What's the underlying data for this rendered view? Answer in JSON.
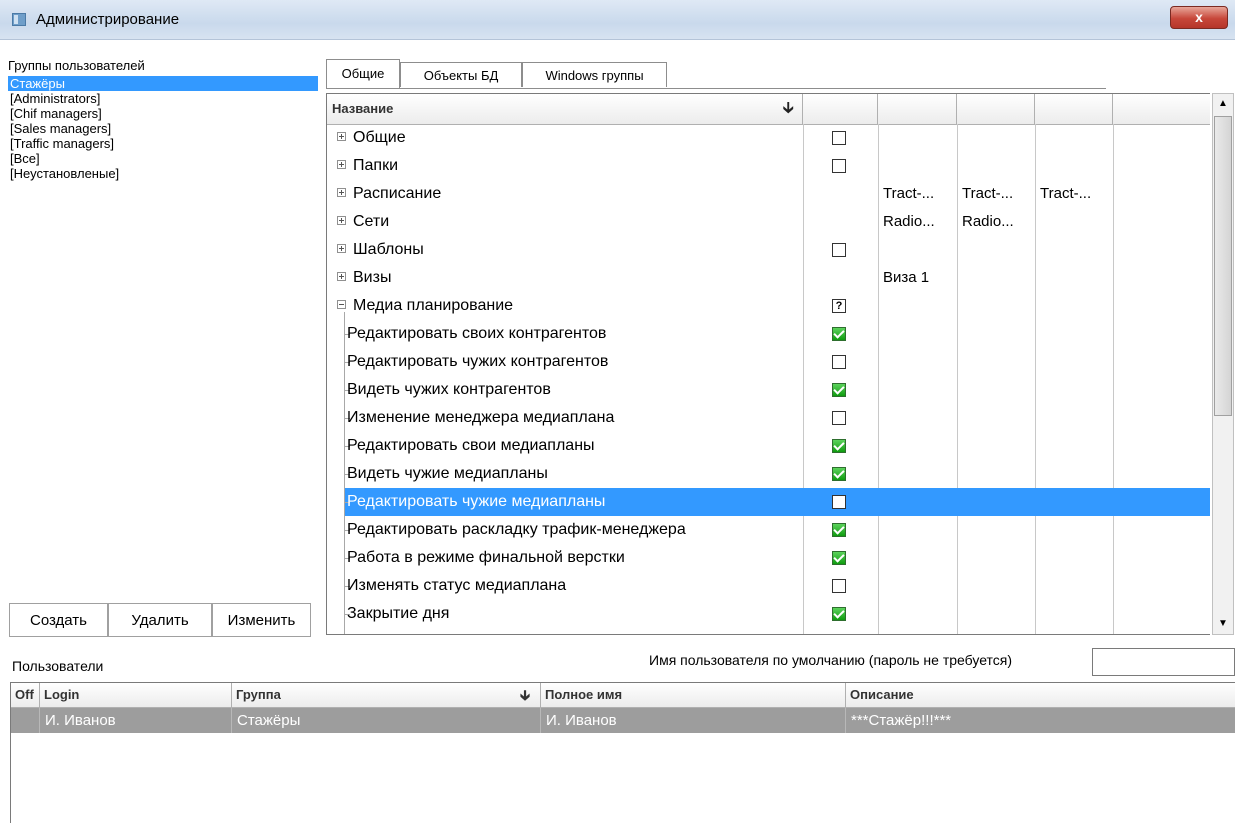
{
  "window": {
    "title": "Администрирование",
    "close_label": "x"
  },
  "groups": {
    "label": "Группы пользователей",
    "items": [
      "Стажёры",
      "[Administrators]",
      "[Chif managers]",
      "[Sales managers]",
      "[Traffic managers]",
      "[Все]",
      "[Неустановленые]"
    ],
    "selected_index": 0,
    "buttons": {
      "create": "Создать",
      "delete": "Удалить",
      "edit": "Изменить"
    }
  },
  "tabs": [
    "Общие",
    "Объекты БД",
    "Windows группы"
  ],
  "grid": {
    "header_name": "Название",
    "sort_icon": "down-arrow-icon",
    "rows": [
      {
        "name": "Общие",
        "type": "group",
        "toggle": "+",
        "check": "unchecked",
        "c1": "",
        "c2": "",
        "c3": ""
      },
      {
        "name": "Папки",
        "type": "group",
        "toggle": "+",
        "check": "unchecked",
        "c1": "",
        "c2": "",
        "c3": ""
      },
      {
        "name": "Расписание",
        "type": "group",
        "toggle": "+",
        "check": "none",
        "c1": "Tract-...",
        "c2": "Tract-...",
        "c3": "Tract-..."
      },
      {
        "name": "Сети",
        "type": "group",
        "toggle": "+",
        "check": "none",
        "c1": "Radio...",
        "c2": "Radio...",
        "c3": ""
      },
      {
        "name": "Шаблоны",
        "type": "group",
        "toggle": "+",
        "check": "unchecked",
        "c1": "",
        "c2": "",
        "c3": ""
      },
      {
        "name": "Визы",
        "type": "group",
        "toggle": "+",
        "check": "none",
        "c1": "Виза 1",
        "c2": "",
        "c3": ""
      },
      {
        "name": "Медиа планирование",
        "type": "group",
        "toggle": "-",
        "check": "indeterminate",
        "c1": "",
        "c2": "",
        "c3": ""
      },
      {
        "name": "Редактировать своих контрагентов",
        "type": "child",
        "check": "checked",
        "c1": "",
        "c2": "",
        "c3": ""
      },
      {
        "name": "Редактировать чужих контрагентов",
        "type": "child",
        "check": "unchecked",
        "c1": "",
        "c2": "",
        "c3": ""
      },
      {
        "name": "Видеть чужих контрагентов",
        "type": "child",
        "check": "checked",
        "c1": "",
        "c2": "",
        "c3": ""
      },
      {
        "name": "Изменение менеджера медиаплана",
        "type": "child",
        "check": "unchecked",
        "c1": "",
        "c2": "",
        "c3": ""
      },
      {
        "name": "Редактировать свои медиапланы",
        "type": "child",
        "check": "checked",
        "c1": "",
        "c2": "",
        "c3": ""
      },
      {
        "name": "Видеть чужие медиапланы",
        "type": "child",
        "check": "checked",
        "c1": "",
        "c2": "",
        "c3": ""
      },
      {
        "name": "Редактировать чужие медиапланы",
        "type": "child",
        "check": "unchecked",
        "c1": "",
        "c2": "",
        "c3": "",
        "selected": true
      },
      {
        "name": "Редактировать раскладку трафик-менеджера",
        "type": "child",
        "check": "checked",
        "c1": "",
        "c2": "",
        "c3": ""
      },
      {
        "name": "Работа в режиме финальной верстки",
        "type": "child",
        "check": "checked",
        "c1": "",
        "c2": "",
        "c3": ""
      },
      {
        "name": "Изменять статус медиаплана",
        "type": "child",
        "check": "unchecked",
        "c1": "",
        "c2": "",
        "c3": ""
      },
      {
        "name": "Закрытие дня",
        "type": "child",
        "check": "checked",
        "c1": "",
        "c2": "",
        "c3": ""
      }
    ]
  },
  "users": {
    "label": "Пользователи",
    "default_user_label": "Имя пользователя по умолчанию (пароль не требуется)",
    "default_user_value": "",
    "columns": {
      "off": "Off",
      "login": "Login",
      "group": "Группа",
      "fullname": "Полное имя",
      "description": "Описание"
    },
    "rows": [
      {
        "off": "",
        "login": "И. Иванов",
        "group": "Стажёры",
        "fullname": "И. Иванов",
        "description": "***Стажёр!!!***"
      }
    ]
  },
  "colors": {
    "selection": "#3399ff",
    "check_green": "#1aa61a",
    "user_row": "#9d9d9d"
  }
}
